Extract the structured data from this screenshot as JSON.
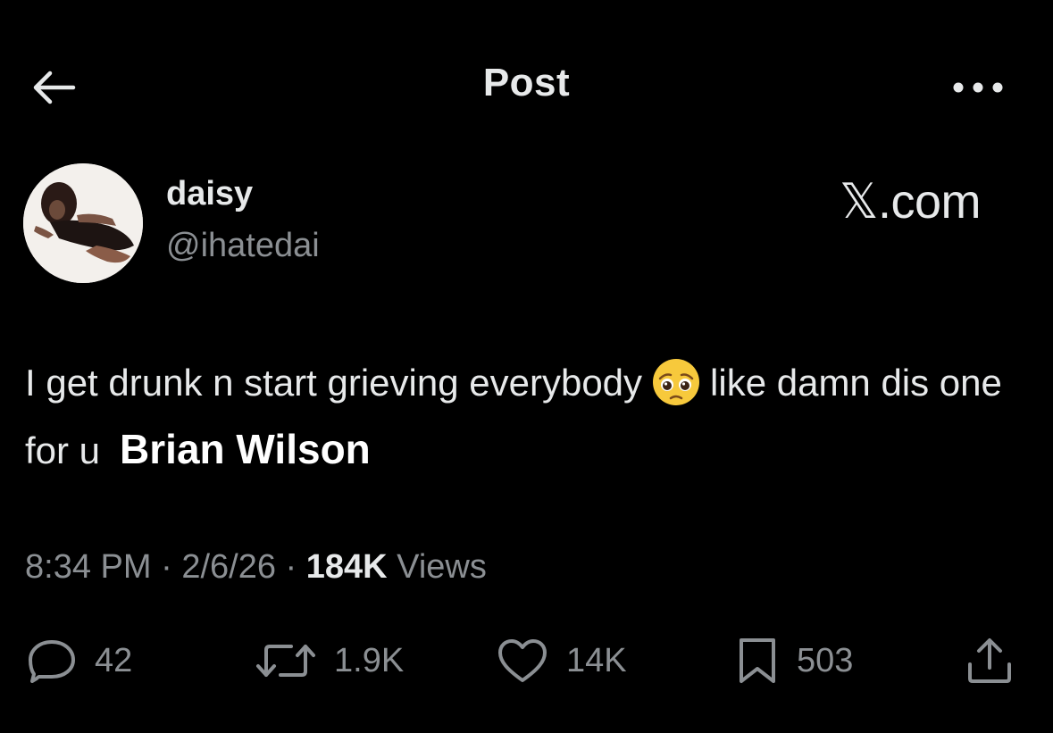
{
  "header": {
    "title": "Post"
  },
  "author": {
    "name": "daisy",
    "handle": "@ihatedai"
  },
  "source_label": "𝕏.com",
  "tweet": {
    "text_part1": "I get drunk n start grieving everybody",
    "emoji": "pleading-face-emoji",
    "text_part2": "like damn dis one for u",
    "overlay_text": "Brian Wilson"
  },
  "meta": {
    "time": "8:34 PM",
    "separator": "·",
    "date": "2/6/26",
    "views_count": "184K",
    "views_label": "Views"
  },
  "actions": {
    "replies": "42",
    "reposts": "1.9K",
    "likes": "14K",
    "bookmarks": "503"
  },
  "colors": {
    "background": "#000000",
    "primary_text": "#e7e9ea",
    "secondary_text": "#8b8f93"
  }
}
